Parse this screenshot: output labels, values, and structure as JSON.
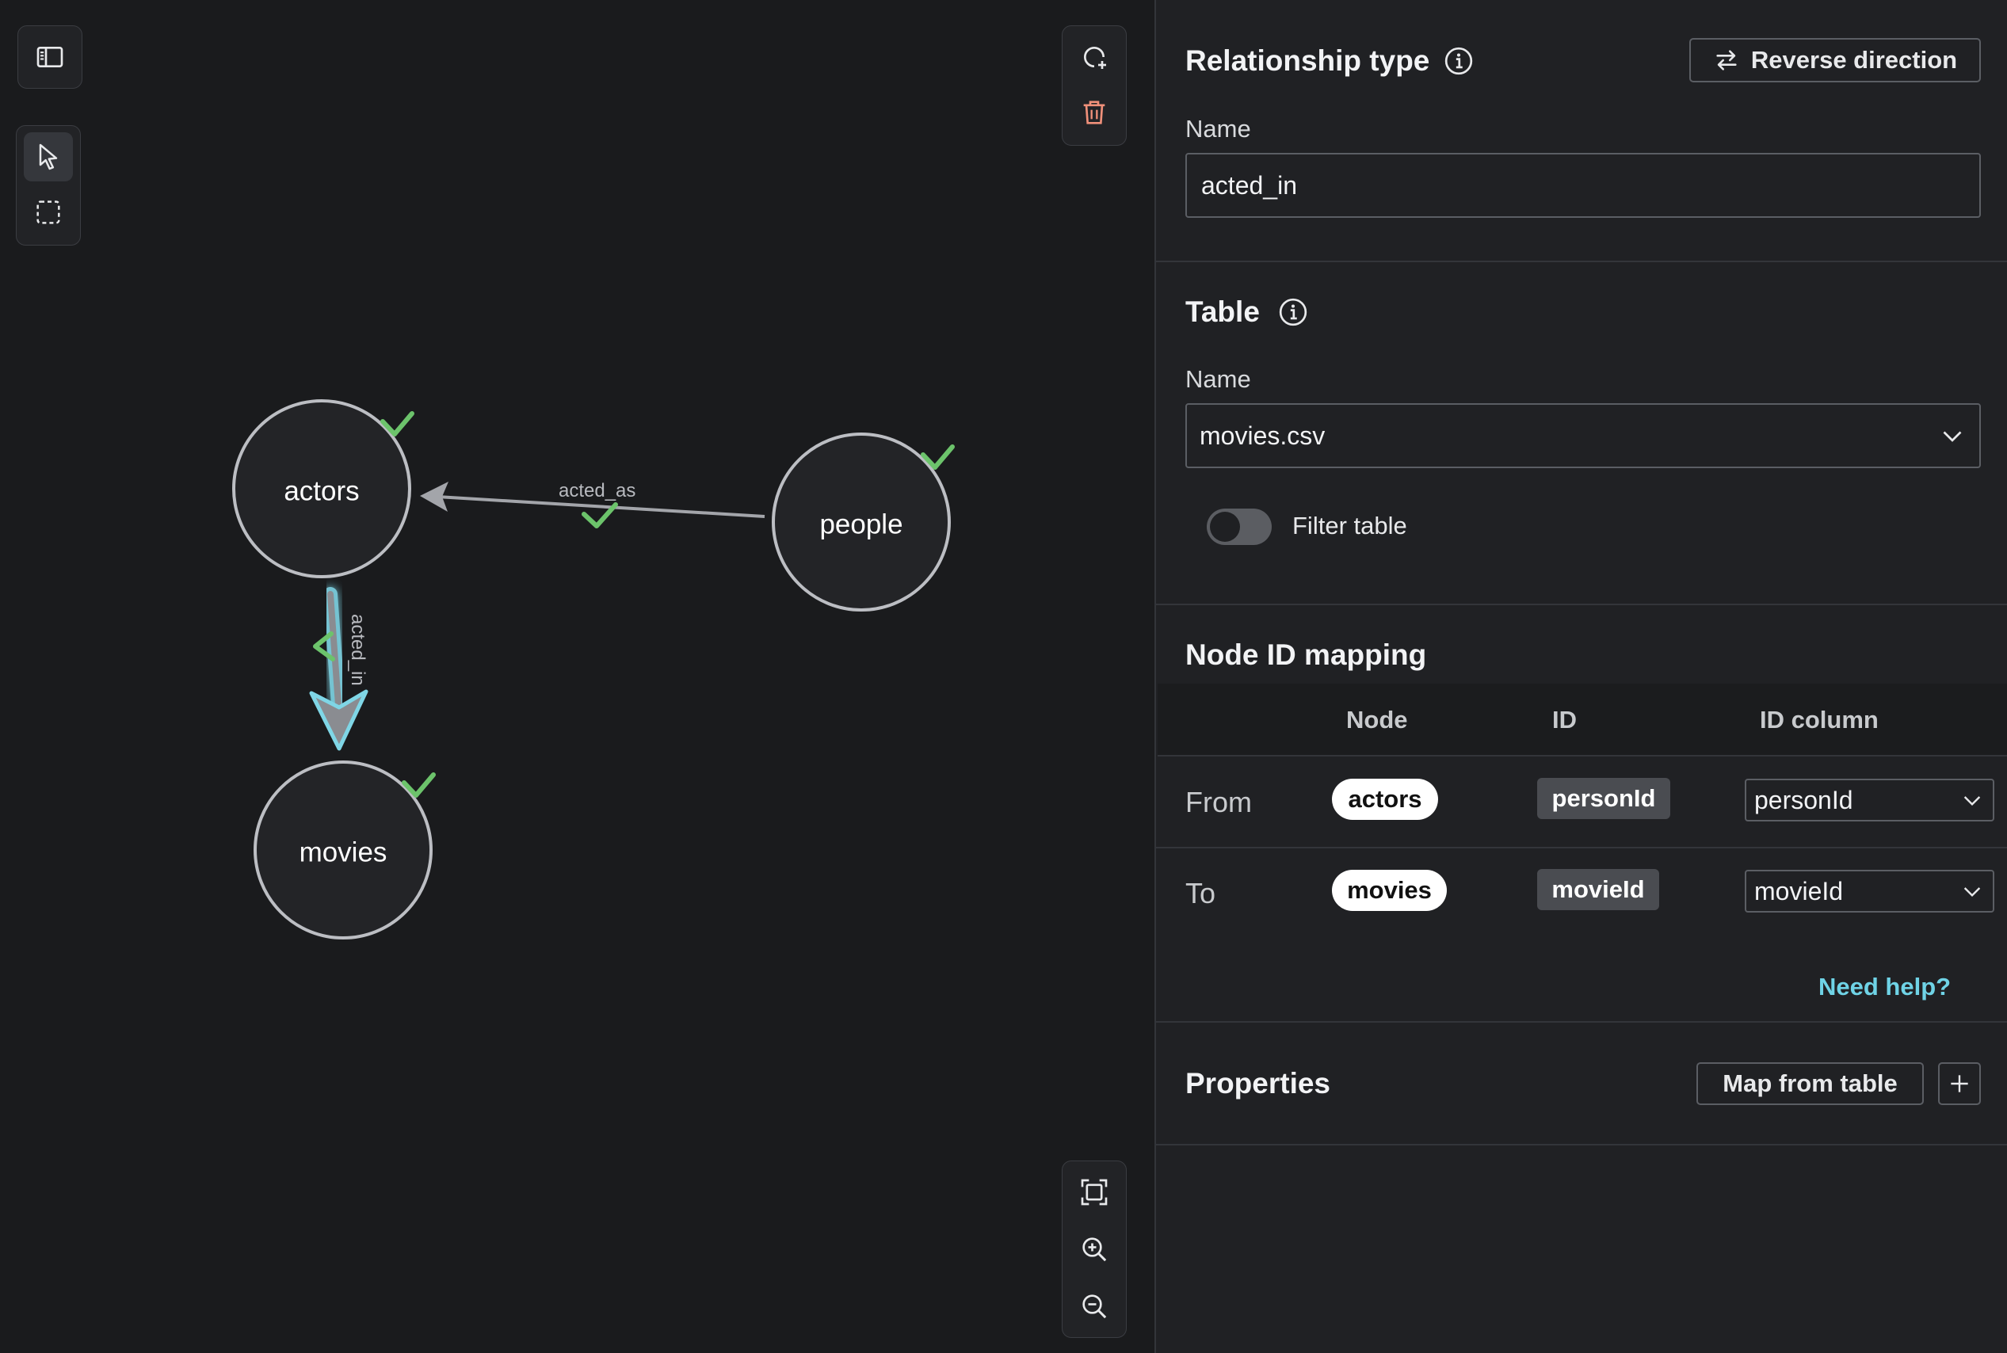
{
  "canvas": {
    "nodes": [
      {
        "id": "actors",
        "label": "actors"
      },
      {
        "id": "people",
        "label": "people"
      },
      {
        "id": "movies",
        "label": "movies"
      }
    ],
    "edges": [
      {
        "label": "acted_as",
        "from": "people",
        "to": "actors"
      },
      {
        "label": "acted_in",
        "from": "actors",
        "to": "movies",
        "selected": true
      }
    ]
  },
  "panel": {
    "relationship": {
      "title": "Relationship type",
      "reverse_label": "Reverse direction",
      "name_label": "Name",
      "name_value": "acted_in"
    },
    "table": {
      "title": "Table",
      "name_label": "Name",
      "selected": "movies.csv",
      "filter_label": "Filter table",
      "filter_on": false
    },
    "mapping": {
      "title": "Node ID mapping",
      "columns": [
        "Node",
        "ID",
        "ID column"
      ],
      "rows": [
        {
          "label": "From",
          "node": "actors",
          "id": "personId",
          "column": "personId"
        },
        {
          "label": "To",
          "node": "movies",
          "id": "movieId",
          "column": "movieId"
        }
      ],
      "help": "Need help?"
    },
    "properties": {
      "title": "Properties",
      "map_button": "Map from table"
    }
  },
  "colors": {
    "accent": "#6fd3e6",
    "check": "#6cc36b",
    "delete": "#f0907a"
  }
}
